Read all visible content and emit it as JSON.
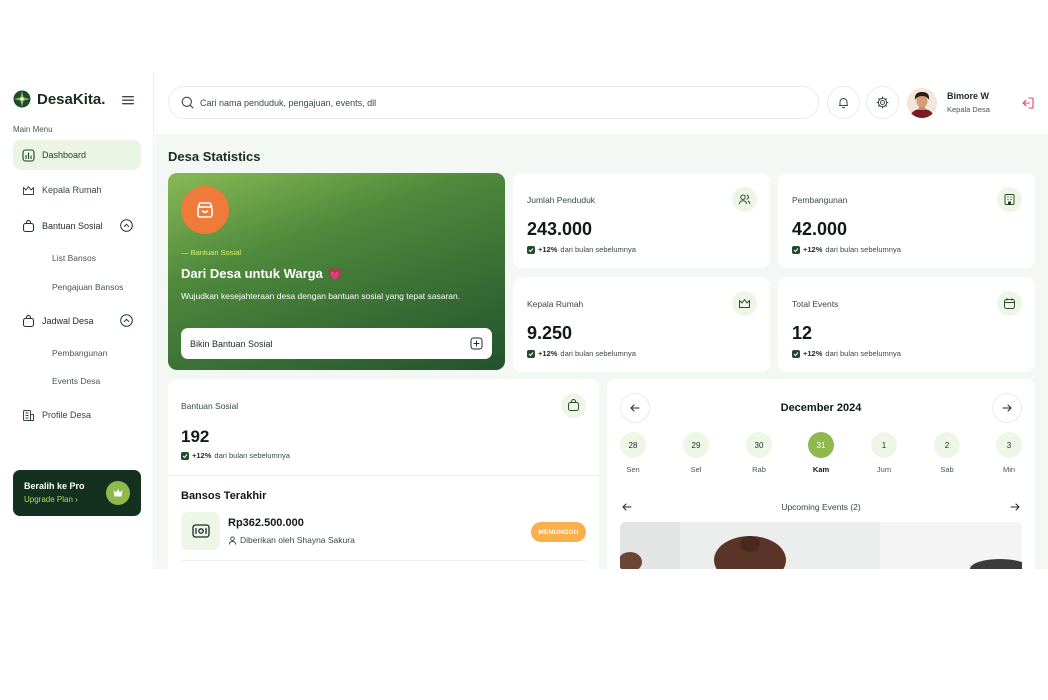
{
  "brand": {
    "name": "DesaKita."
  },
  "sidebar": {
    "heading": "Main Menu",
    "items": [
      {
        "label": "Dashboard",
        "icon": "chart-icon",
        "active": true
      },
      {
        "label": "Kepala Rumah",
        "icon": "crown-icon"
      },
      {
        "label": "Bantuan Sosial",
        "icon": "bag-icon",
        "expanded": true
      },
      {
        "label": "List Bansos",
        "sub": true
      },
      {
        "label": "Pengajuan Bansos",
        "sub": true
      },
      {
        "label": "Jadwal Desa",
        "icon": "bag-icon",
        "expanded": true
      },
      {
        "label": "Pembangunan",
        "sub": true
      },
      {
        "label": "Events Desa",
        "sub": true
      },
      {
        "label": "Profile Desa",
        "icon": "building-icon"
      }
    ],
    "pro": {
      "title": "Beralih ke Pro",
      "link": "Upgrade Plan ›"
    }
  },
  "header": {
    "search_placeholder": "Cari nama penduduk, pengajuan, events, dll",
    "user": {
      "name": "Bimore W",
      "role": "Kepala Desa"
    }
  },
  "main": {
    "title": "Desa Statistics",
    "hero": {
      "kicker": "— Bantuan Sosial",
      "title": "Dari Desa untuk Warga",
      "emoji": "💗",
      "desc": "Wujudkan kesejahteraan desa dengan bantuan sosial yang tepat sasaran.",
      "cta": "Bikin Bantuan Sosial"
    },
    "stats": [
      {
        "label": "Jumlah Penduduk",
        "value": "243.000",
        "change": "+12%",
        "change_text": "dari bulan sebelumnya",
        "icon": "users-icon"
      },
      {
        "label": "Pembangunan",
        "value": "42.000",
        "change": "+12%",
        "change_text": "dari bulan sebelumnya",
        "icon": "building-icon"
      },
      {
        "label": "Kepala Rumah",
        "value": "9.250",
        "change": "+12%",
        "change_text": "dari bulan sebelumnya",
        "icon": "crown-icon"
      },
      {
        "label": "Total Events",
        "value": "12",
        "change": "+12%",
        "change_text": "dari bulan sebelumnya",
        "icon": "calendar-icon"
      }
    ],
    "bansos": {
      "label": "Bantuan Sosial",
      "value": "192",
      "change": "+12%",
      "change_text": "dari bulan sebelumnya",
      "recent_title": "Bansos Terakhir",
      "recent": [
        {
          "amount": "Rp362.500.000",
          "by": "Diberikan oleh Shayna Sakura",
          "status": "MENUNGGU"
        }
      ]
    },
    "calendar": {
      "month": "December 2024",
      "days": [
        {
          "num": "28",
          "name": "Sen"
        },
        {
          "num": "29",
          "name": "Sel"
        },
        {
          "num": "30",
          "name": "Rab"
        },
        {
          "num": "31",
          "name": "Kam",
          "active": true
        },
        {
          "num": "1",
          "name": "Jum"
        },
        {
          "num": "2",
          "name": "Sab"
        },
        {
          "num": "3",
          "name": "Min"
        }
      ],
      "upcoming_title": "Upcoming Events (2)"
    }
  },
  "colors": {
    "accent": "#8fb84e",
    "dark_green": "#14301f",
    "orange": "#f07a3a",
    "status_pending": "#f9b04c",
    "danger": "#e0455a"
  }
}
